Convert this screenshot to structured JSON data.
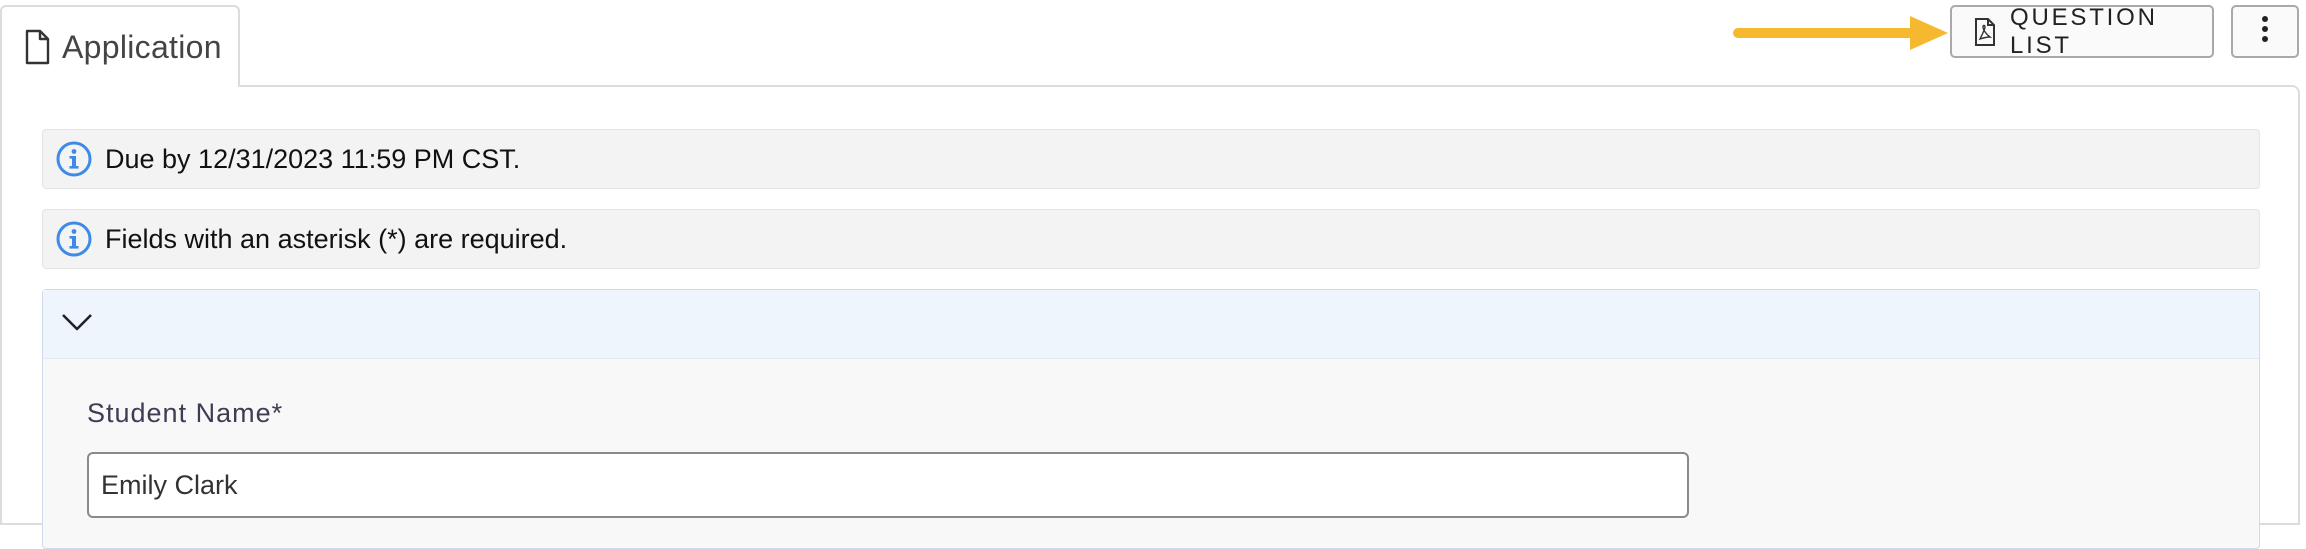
{
  "tab": {
    "label": "Application",
    "icon": "document-icon"
  },
  "toolbar": {
    "question_list_label": "QUESTION LIST",
    "question_list_icon": "pdf-icon",
    "more_icon": "kebab-menu-icon",
    "arrow_color": "#f5b82e"
  },
  "notices": [
    {
      "text": "Due by 12/31/2023 11:59 PM CST.",
      "icon": "info-icon"
    },
    {
      "text": "Fields with an asterisk (*) are required.",
      "icon": "info-icon"
    }
  ],
  "section": {
    "toggle_icon": "chevron-down-icon",
    "fields": [
      {
        "label": "Student Name*",
        "value": "Emily Clark"
      }
    ]
  },
  "colors": {
    "info_blue": "#3d8ae8",
    "section_header_bg": "#eef5fd"
  }
}
